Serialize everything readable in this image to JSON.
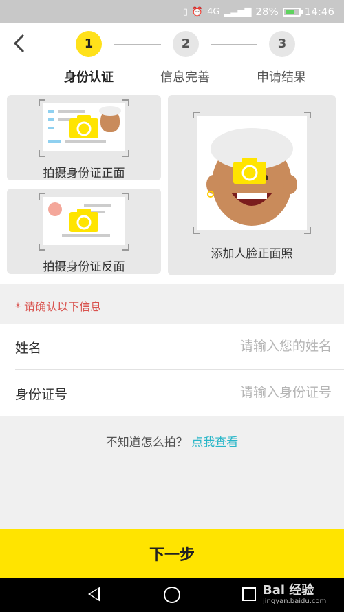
{
  "status_bar": {
    "icons": [
      "vibrate-icon",
      "alarm-icon",
      "signal-icon"
    ],
    "network": "4G",
    "battery": "28%",
    "time": "14:46"
  },
  "header": {
    "steps": [
      {
        "number": "1",
        "label": "身份认证",
        "active": true
      },
      {
        "number": "2",
        "label": "信息完善",
        "active": false
      },
      {
        "number": "3",
        "label": "申请结果",
        "active": false
      }
    ]
  },
  "cards": {
    "id_front": "拍摄身份证正面",
    "id_back": "拍摄身份证反面",
    "face": "添加人脸正面照"
  },
  "note": "* 请确认以下信息",
  "form": {
    "name_label": "姓名",
    "name_placeholder": "请输入您的姓名",
    "id_label": "身份证号",
    "id_placeholder": "请输入身份证号"
  },
  "help": {
    "text": "不知道怎么拍？",
    "link": "点我查看"
  },
  "next_button": "下一步",
  "watermark": {
    "brand": "Bai 经验",
    "url": "jingyan.baidu.com"
  },
  "colors": {
    "accent_yellow": "#ffe400",
    "link_cyan": "#29b6c8",
    "required_red": "#d9534f"
  }
}
